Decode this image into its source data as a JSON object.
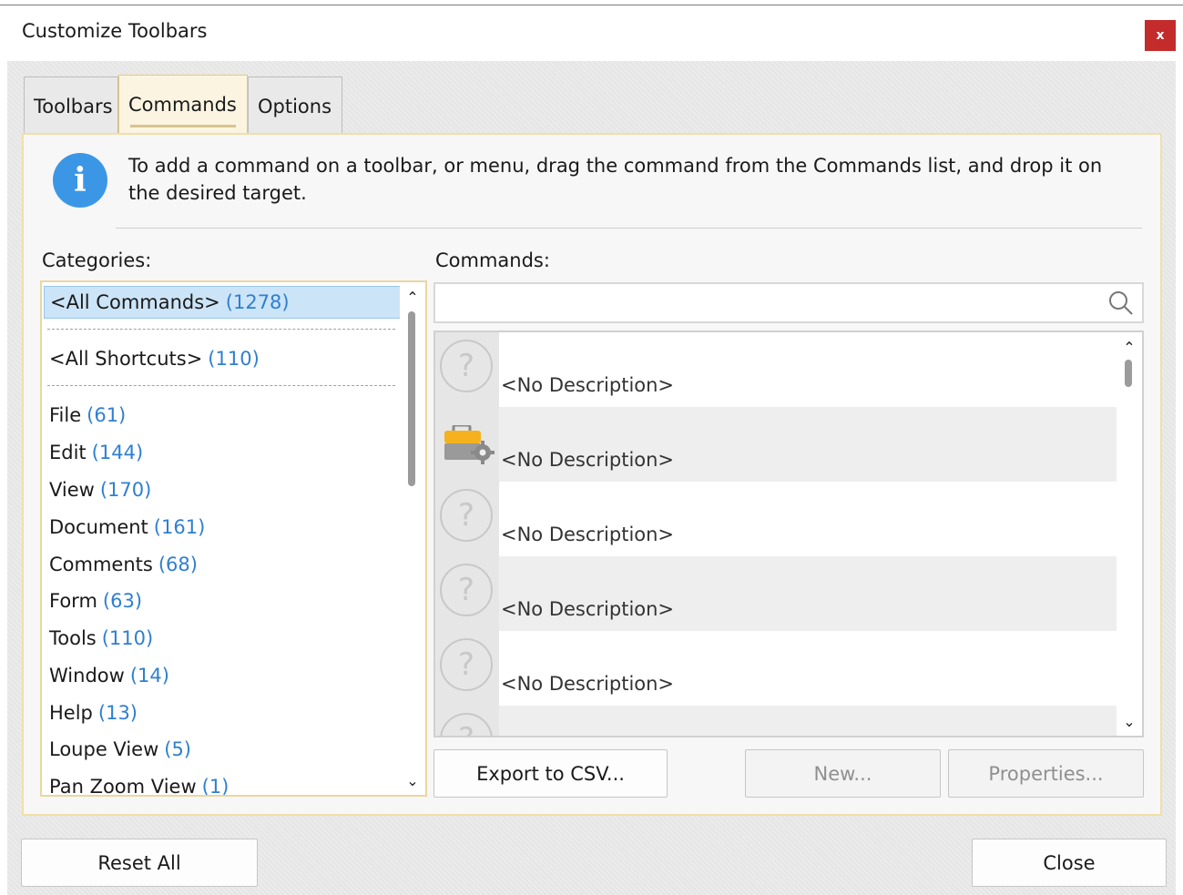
{
  "window": {
    "title": "Customize Toolbars",
    "close_glyph": "x"
  },
  "tabs": [
    {
      "label": "Toolbars"
    },
    {
      "label": "Commands"
    },
    {
      "label": "Options"
    }
  ],
  "info": {
    "icon": "info-icon",
    "text": "To add a command on a toolbar, or menu, drag the command from the Commands list, and drop it on the desired target."
  },
  "categories": {
    "label": "Categories:",
    "items": [
      {
        "name": "<All Commands>",
        "count": "(1278)"
      },
      {
        "name": "<All Shortcuts>",
        "count": "(110)"
      },
      {
        "name": "File",
        "count": "(61)"
      },
      {
        "name": "Edit",
        "count": "(144)"
      },
      {
        "name": "View",
        "count": "(170)"
      },
      {
        "name": "Document",
        "count": "(161)"
      },
      {
        "name": "Comments",
        "count": "(68)"
      },
      {
        "name": "Form",
        "count": "(63)"
      },
      {
        "name": "Tools",
        "count": "(110)"
      },
      {
        "name": "Window",
        "count": "(14)"
      },
      {
        "name": "Help",
        "count": "(13)"
      },
      {
        "name": "Loupe View",
        "count": "(5)"
      },
      {
        "name": "Pan Zoom View",
        "count": "(1)"
      }
    ]
  },
  "commands": {
    "label": "Commands:",
    "search_value": "",
    "items": [
      {
        "description": "<No Description>",
        "icon": "question-icon"
      },
      {
        "description": "<No Description>",
        "icon": "toolbox-gear-icon"
      },
      {
        "description": "<No Description>",
        "icon": "question-icon"
      },
      {
        "description": "<No Description>",
        "icon": "question-icon"
      },
      {
        "description": "<No Description>",
        "icon": "question-icon"
      }
    ]
  },
  "buttons": {
    "export": "Export to CSV...",
    "new": "New...",
    "properties": "Properties...",
    "reset_all": "Reset All",
    "close": "Close"
  },
  "colors": {
    "accent": "#3b97e6",
    "count": "#2f7fd0",
    "close_bg": "#c42b2b",
    "panel_border": "#f1dfa6"
  }
}
